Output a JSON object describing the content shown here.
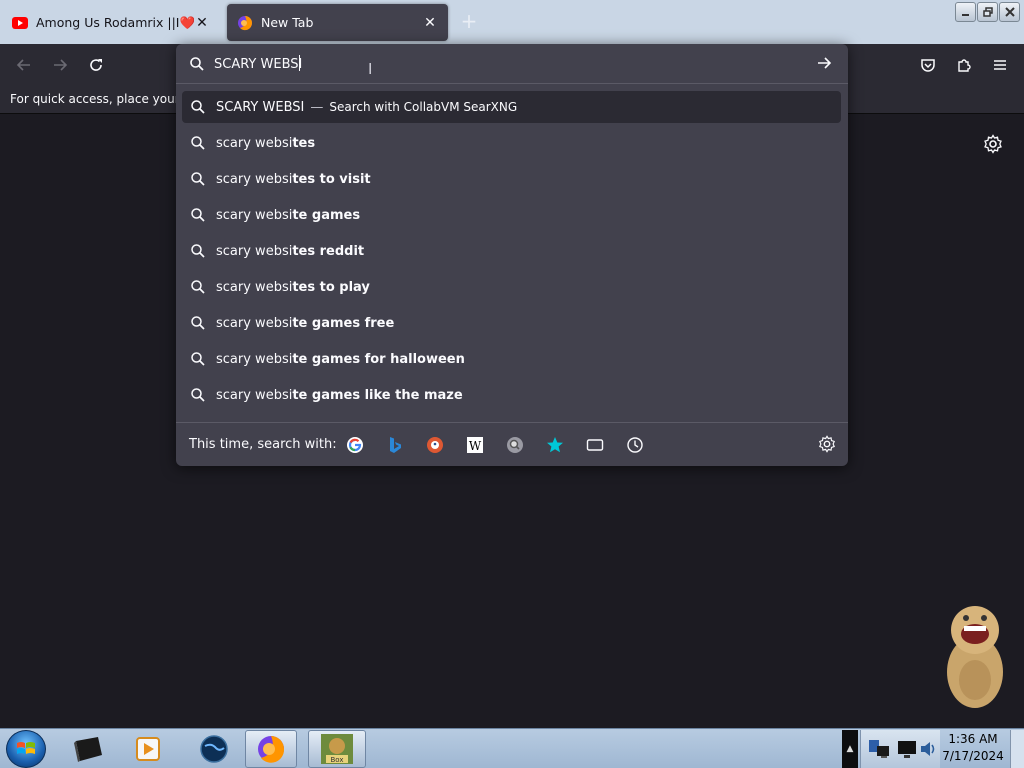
{
  "tabs": [
    {
      "title": "Among Us Rodamrix ||I❤️/LOV",
      "favicon": "youtube-icon",
      "active": false
    },
    {
      "title": "New Tab",
      "favicon": "firefox-icon",
      "active": true
    }
  ],
  "urlbar": {
    "value": "SCARY WEBSI",
    "typed_lower": "scary websi"
  },
  "primary_suggestion": {
    "text": "SCARY WEBSI",
    "separator": "—",
    "action": "Search with CollabVM SearXNG"
  },
  "suggestions": [
    {
      "typed": "scary websi",
      "completion": "tes"
    },
    {
      "typed": "scary websi",
      "completion": "tes to visit"
    },
    {
      "typed": "scary websi",
      "completion": "te games"
    },
    {
      "typed": "scary websi",
      "completion": "tes reddit"
    },
    {
      "typed": "scary websi",
      "completion": "tes to play"
    },
    {
      "typed": "scary websi",
      "completion": "te games free"
    },
    {
      "typed": "scary websi",
      "completion": "te games for halloween"
    },
    {
      "typed": "scary websi",
      "completion": "te games like the maze"
    }
  ],
  "oneoff": {
    "label": "This time, search with:",
    "engines": [
      "google-icon",
      "bing-icon",
      "duckduckgo-icon",
      "wikipedia-icon",
      "searxng-icon",
      "bookmarks-icon",
      "tabs-icon",
      "history-icon"
    ]
  },
  "bookmark_bar": {
    "hint": "For quick access, place your bookmarks here"
  },
  "taskbar": {
    "clock_time": "1:36 AM",
    "clock_date": "7/17/2024"
  },
  "colors": {
    "chrome_dark": "#2b2a33",
    "panel": "#42414d",
    "page_bg": "#1c1b22",
    "accent_bookmark": "#00c8d7"
  }
}
